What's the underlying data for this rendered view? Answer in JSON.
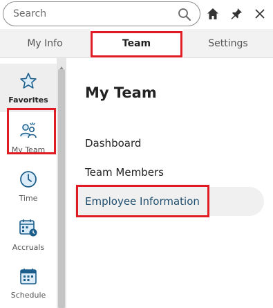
{
  "search": {
    "placeholder": "Search",
    "icon": "magnifier"
  },
  "toolbar": {
    "home_icon": "home",
    "pin_icon": "pin",
    "close_icon": "x"
  },
  "tabs": [
    {
      "label": "My Info",
      "active": false
    },
    {
      "label": "Team",
      "active": true
    },
    {
      "label": "Settings",
      "active": false
    }
  ],
  "sidebar": {
    "items": [
      {
        "label": "Favorites",
        "icon": "star",
        "selected": true
      },
      {
        "label": "My Team",
        "icon": "team",
        "selected": false
      },
      {
        "label": "Time",
        "icon": "clock",
        "selected": false
      },
      {
        "label": "Accruals",
        "icon": "calendar-clock",
        "selected": false
      },
      {
        "label": "Schedule",
        "icon": "calendar",
        "selected": false
      }
    ]
  },
  "main": {
    "title": "My Team",
    "menu": [
      {
        "label": "Dashboard",
        "selected": false
      },
      {
        "label": "Team Members",
        "selected": false
      },
      {
        "label": "Employee Information",
        "selected": true
      }
    ]
  },
  "colors": {
    "accent": "#1b5e8c",
    "highlight": "#e01b24",
    "selected_text": "#1f4e6e"
  }
}
